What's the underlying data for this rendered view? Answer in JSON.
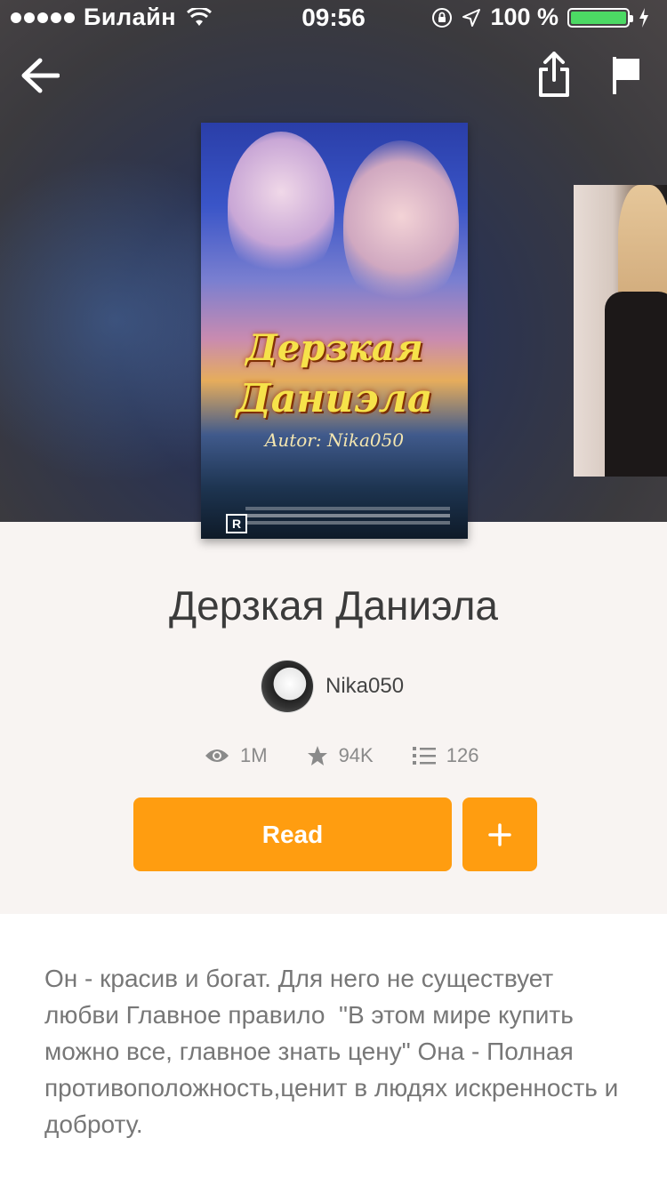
{
  "status_bar": {
    "carrier": "Билайн",
    "time": "09:56",
    "battery_percent": "100 %",
    "battery_level": 1.0,
    "battery_color": "#4cd964"
  },
  "nav": {
    "back_icon": "arrow-left-icon",
    "share_icon": "share-icon",
    "report_icon": "flag-icon"
  },
  "cover": {
    "title_line1": "Дерзкая",
    "title_line2": "Даниэла",
    "author_line": "Autor: Nika050",
    "rating": "R"
  },
  "story": {
    "title": "Дерзкая Даниэла",
    "author": "Nika050",
    "stats": {
      "reads": "1M",
      "votes": "94K",
      "parts": "126"
    },
    "description": "Он - красив и богат. Для него не существует любви Главное правило  \"В этом мире купить можно все, главное знать цену\" Она - Полная противоположность,ценит в людях искренность и доброту."
  },
  "actions": {
    "read_label": "Read",
    "add_icon": "plus-icon"
  },
  "colors": {
    "accent": "#ff9d10",
    "text_dark": "#3b3b3b",
    "text_muted": "#8a8a8a",
    "page_bg": "#f8f4f2"
  }
}
